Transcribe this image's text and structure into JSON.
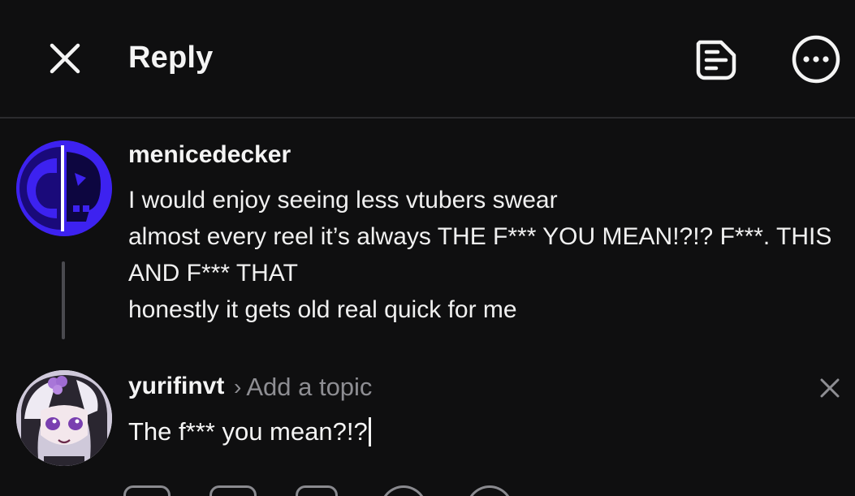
{
  "header": {
    "title": "Reply"
  },
  "original_post": {
    "username": "menicedecker",
    "lines": [
      "I would enjoy seeing less vtubers swear",
      "almost every reel it’s always THE F*** YOU MEAN!?!? F***. THIS",
      "AND F*** THAT",
      "honestly it gets old real quick for me"
    ]
  },
  "composer": {
    "username": "yurifinvt",
    "topic_placeholder": "Add a topic",
    "text": "The f*** you mean?!?"
  },
  "colors": {
    "background": "#0f0f10",
    "text": "#f4f4f4",
    "muted": "#8e8e93",
    "avatar_op_accent": "#3d1fe0"
  },
  "icons": {
    "close": "close-icon",
    "draft": "draft-note-icon",
    "more": "more-options-icon",
    "clear": "clear-icon"
  }
}
